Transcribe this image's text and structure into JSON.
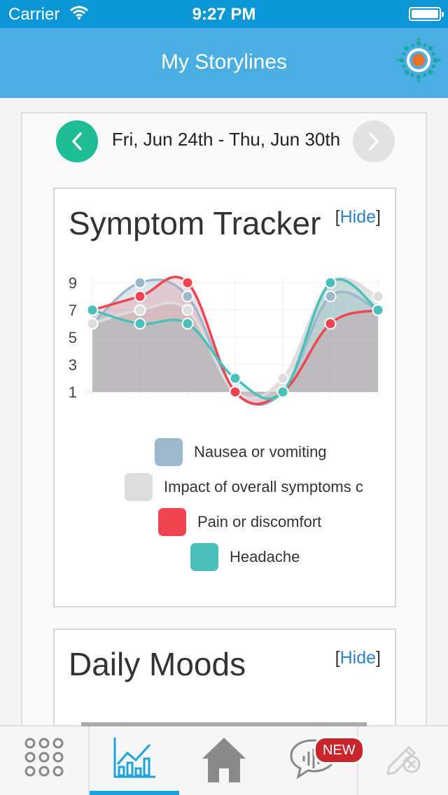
{
  "status": {
    "carrier": "Carrier",
    "time": "9:27 PM"
  },
  "nav": {
    "title": "My Storylines",
    "logo_icon": "storyline-logo-icon"
  },
  "date_nav": {
    "range": "Fri, Jun 24th - Thu, Jun 30th",
    "prev_icon": "chevron-left-icon",
    "next_icon": "chevron-right-icon"
  },
  "symptom_card": {
    "title": "Symptom Tracker",
    "hide_open": "[",
    "hide_label": "Hide",
    "hide_close": "]"
  },
  "moods_card": {
    "title": "Daily Moods",
    "hide_open": "[",
    "hide_label": "Hide",
    "hide_close": "]"
  },
  "chart_data": {
    "type": "area",
    "title": "",
    "xlabel": "",
    "ylabel": "",
    "x": [
      1,
      2,
      3,
      4,
      5,
      6,
      7
    ],
    "yticks": [
      1,
      3,
      5,
      7,
      9
    ],
    "ylim": [
      1,
      9
    ],
    "grid": true,
    "legend_position": "bottom",
    "series": [
      {
        "name": "Nausea or vomiting",
        "color": "#9bb8cc",
        "values": [
          6,
          9,
          8,
          1,
          1,
          8,
          7
        ]
      },
      {
        "name": "Impact of overall symptoms on daily activities",
        "color": "#dddddd",
        "values": [
          6,
          7,
          7,
          1,
          2,
          9,
          8
        ]
      },
      {
        "name": "Pain or discomfort",
        "color": "#f04550",
        "values": [
          7,
          8,
          9,
          1,
          1,
          6,
          7
        ]
      },
      {
        "name": "Headache",
        "color": "#4bbfb9",
        "values": [
          7,
          6,
          6,
          2,
          1,
          9,
          7
        ]
      }
    ],
    "legend_labels": [
      "Nausea or vomiting",
      "Impact of overall symptoms c",
      "Pain or discomfort",
      "Headache"
    ]
  },
  "tabs": [
    {
      "name": "menu",
      "icon": "grid-menu-icon"
    },
    {
      "name": "storylines",
      "icon": "line-chart-icon",
      "active": true
    },
    {
      "name": "home",
      "icon": "home-icon"
    },
    {
      "name": "messages",
      "icon": "chat-bubble-icon",
      "badge": "NEW"
    },
    {
      "name": "edit",
      "icon": "pencil-cancel-icon"
    }
  ]
}
